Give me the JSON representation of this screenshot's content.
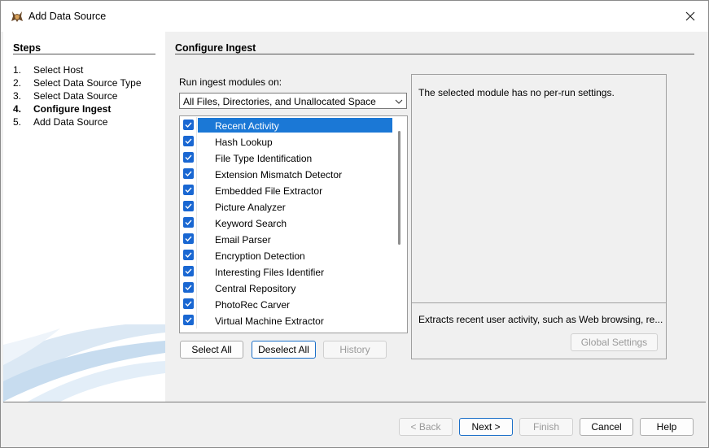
{
  "window": {
    "title": "Add Data Source",
    "app_icon": "autopsy-dog-icon",
    "close_icon": "close-icon"
  },
  "steps": {
    "heading": "Steps",
    "items": [
      {
        "num": "1.",
        "label": "Select Host",
        "current": false
      },
      {
        "num": "2.",
        "label": "Select Data Source Type",
        "current": false
      },
      {
        "num": "3.",
        "label": "Select Data Source",
        "current": false
      },
      {
        "num": "4.",
        "label": "Configure Ingest",
        "current": true
      },
      {
        "num": "5.",
        "label": "Add Data Source",
        "current": false
      }
    ]
  },
  "main": {
    "heading": "Configure Ingest",
    "run_label": "Run ingest modules on:",
    "run_selected": "All Files, Directories, and Unallocated Space",
    "modules": [
      {
        "label": "Recent Activity",
        "checked": true,
        "selected": true
      },
      {
        "label": "Hash Lookup",
        "checked": true,
        "selected": false
      },
      {
        "label": "File Type Identification",
        "checked": true,
        "selected": false
      },
      {
        "label": "Extension Mismatch Detector",
        "checked": true,
        "selected": false
      },
      {
        "label": "Embedded File Extractor",
        "checked": true,
        "selected": false
      },
      {
        "label": "Picture Analyzer",
        "checked": true,
        "selected": false
      },
      {
        "label": "Keyword Search",
        "checked": true,
        "selected": false
      },
      {
        "label": "Email Parser",
        "checked": true,
        "selected": false
      },
      {
        "label": "Encryption Detection",
        "checked": true,
        "selected": false
      },
      {
        "label": "Interesting Files Identifier",
        "checked": true,
        "selected": false
      },
      {
        "label": "Central Repository",
        "checked": true,
        "selected": false
      },
      {
        "label": "PhotoRec Carver",
        "checked": true,
        "selected": false
      },
      {
        "label": "Virtual Machine Extractor",
        "checked": true,
        "selected": false
      }
    ],
    "select_all": "Select All",
    "deselect_all": "Deselect All",
    "history": "History",
    "settings_message": "The selected module has no per-run settings.",
    "module_description": "Extracts recent user activity, such as Web browsing, re...",
    "global_settings": "Global Settings"
  },
  "footer": {
    "back": "< Back",
    "next": "Next >",
    "finish": "Finish",
    "cancel": "Cancel",
    "help": "Help"
  },
  "colors": {
    "accent": "#1b78d6",
    "checkbox": "#1967d2"
  }
}
